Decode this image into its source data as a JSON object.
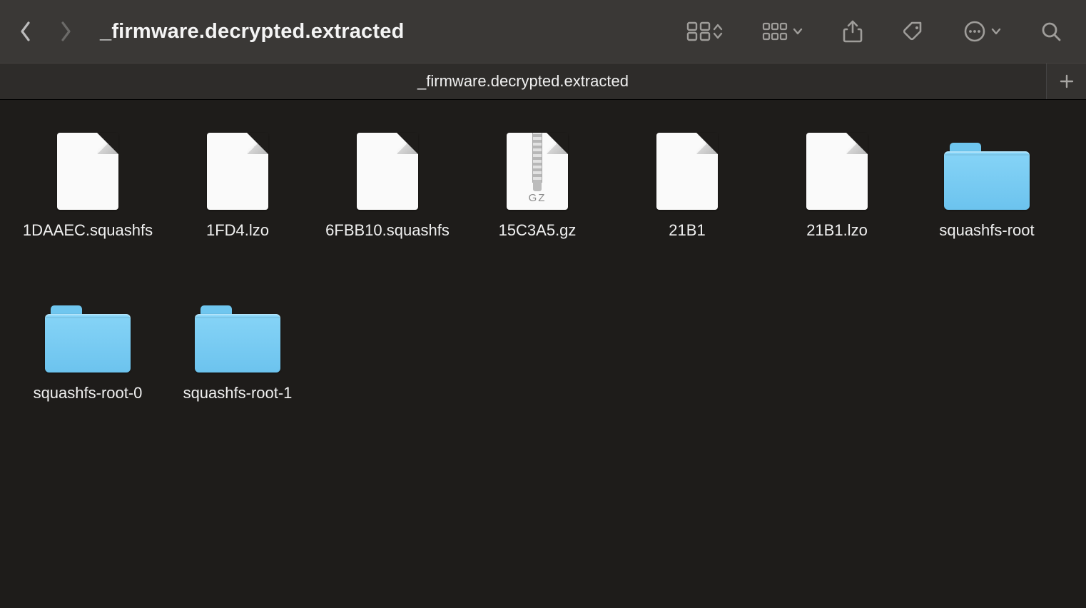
{
  "window": {
    "title": "_firmware.decrypted.extracted"
  },
  "tabs": [
    {
      "label": "_firmware.decrypted.extracted",
      "active": true
    }
  ],
  "items": [
    {
      "name": "1DAAEC.squashfs",
      "kind": "file"
    },
    {
      "name": "1FD4.lzo",
      "kind": "file"
    },
    {
      "name": "6FBB10.squashfs",
      "kind": "file"
    },
    {
      "name": "15C3A5.gz",
      "kind": "archive",
      "tag": "GZ"
    },
    {
      "name": "21B1",
      "kind": "file"
    },
    {
      "name": "21B1.lzo",
      "kind": "file"
    },
    {
      "name": "squashfs-root",
      "kind": "folder"
    },
    {
      "name": "squashfs-root-0",
      "kind": "folder"
    },
    {
      "name": "squashfs-root-1",
      "kind": "folder"
    }
  ]
}
